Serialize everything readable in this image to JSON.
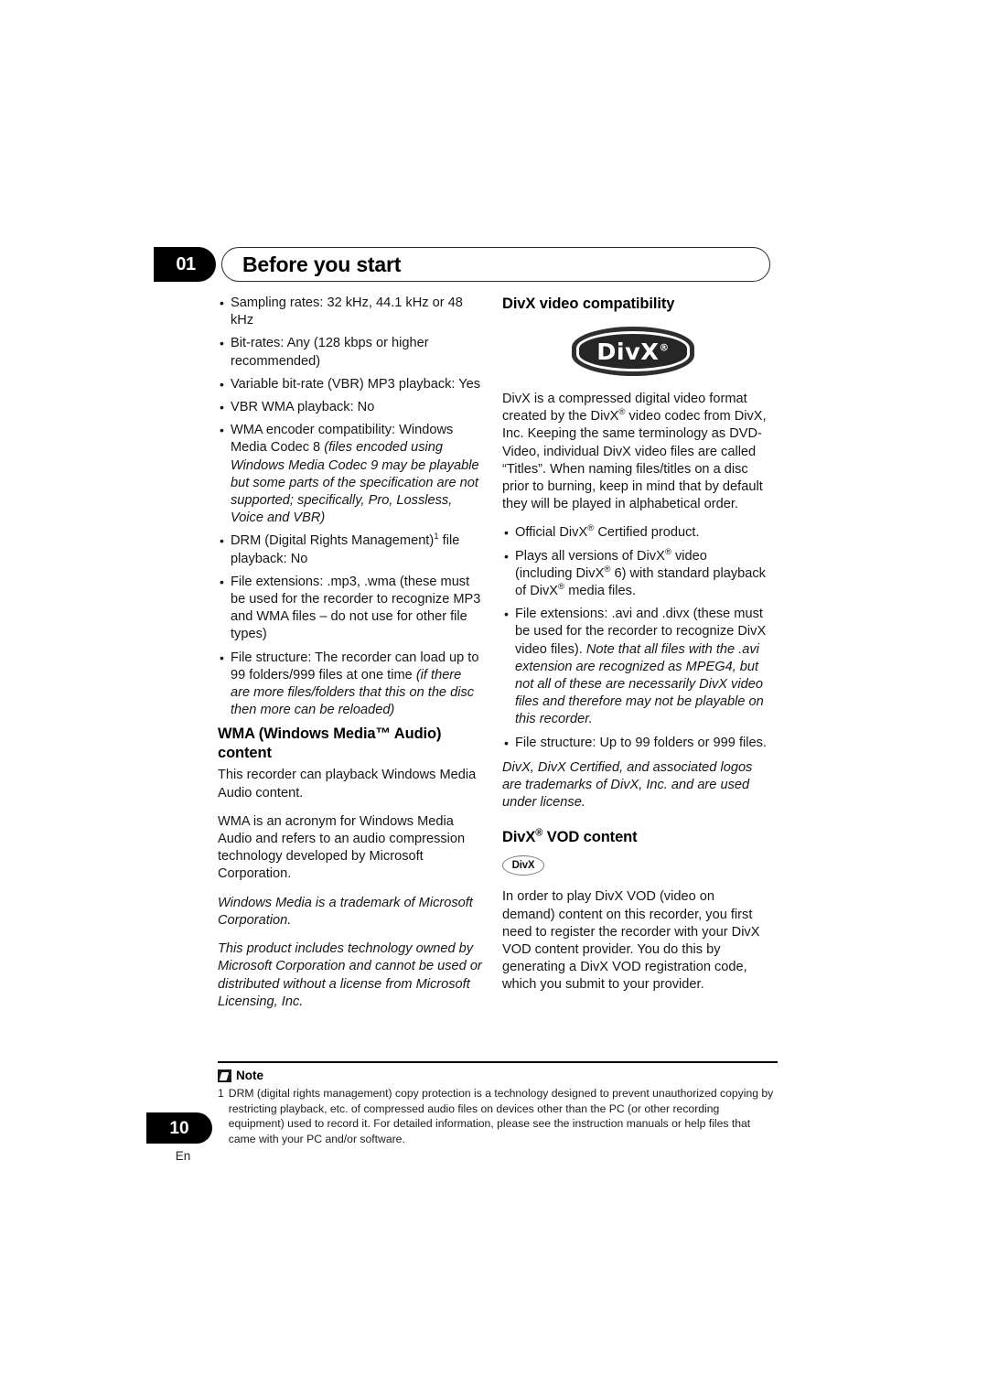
{
  "header": {
    "chapter_number": "01",
    "title": "Before you start"
  },
  "left_column": {
    "spec_bullets": [
      "Sampling rates: 32 kHz, 44.1 kHz or 48 kHz",
      "Bit-rates: Any (128 kbps or higher recommended)",
      "Variable bit-rate (VBR) MP3 playback: Yes",
      "VBR WMA playback: No"
    ],
    "wma_encoder_bullet": {
      "roman": "WMA encoder compatibility: Windows Media Codec 8 ",
      "italic": "(files encoded using Windows Media Codec 9 may be playable but some parts of the specification are not supported; specifically, Pro, Lossless, Voice and VBR)"
    },
    "drm_bullet": {
      "before_sup": "DRM (Digital Rights Management)",
      "sup": "1",
      "after_sup": " file playback: No"
    },
    "file_extensions_bullet": "File extensions: .mp3, .wma (these must be used for the recorder to recognize MP3 and WMA files – do not use for other file types)",
    "file_structure_bullet": {
      "roman": "File structure: The recorder can load up to 99 folders/999 files at one time ",
      "italic": "(if there are more files/folders that this on the disc then more can be reloaded)"
    },
    "wma_heading_line1": "WMA (Windows Media™ Audio)",
    "wma_heading_line2": "content",
    "wma_para_1": "This recorder can playback Windows Media Audio content.",
    "wma_para_2": "WMA is an acronym for Windows Media Audio and refers to an audio compression technology developed by Microsoft Corporation.",
    "wma_para_3_italic": "Windows Media is a trademark of Microsoft Corporation.",
    "wma_para_4_italic": "This product includes technology owned by Microsoft Corporation and cannot be used or distributed without a license from Microsoft Licensing, Inc."
  },
  "right_column": {
    "divx_heading": "DivX video compatibility",
    "divx_logo_text": "DivX",
    "divx_logo_mark": "®",
    "divx_intro": {
      "part1": "DivX is a compressed digital video format created by the DivX",
      "sup1": "®",
      "part2": " video codec from DivX, Inc. Keeping the same terminology as DVD-Video, individual DivX video files are called “Titles”. When naming files/titles on a disc prior to burning, keep in mind that by default they will be played in alphabetical order."
    },
    "bullet_official": {
      "before": "Official DivX",
      "sup": "®",
      "after": " Certified product."
    },
    "bullet_plays": {
      "p1": "Plays all versions of DivX",
      "s1": "®",
      "p2": " video (including DivX",
      "s2": "®",
      "p3": " 6) with standard playback of DivX",
      "s3": "®",
      "p4": " media files."
    },
    "bullet_file_extensions": {
      "roman": "File extensions: .avi and .divx (these must be used for the recorder to recognize DivX video files). ",
      "italic": "Note that all files with the .avi extension are recognized as MPEG4, but not all of these are necessarily DivX video files and therefore may not be playable on this recorder."
    },
    "bullet_file_structure": "File structure: Up to 99 folders or 999 files.",
    "trademark_note_italic": "DivX, DivX Certified, and associated logos are trademarks of DivX, Inc. and are used under license.",
    "vod_heading": {
      "before": "DivX",
      "sup": "®",
      "after": " VOD content"
    },
    "vod_badge_text": "DivX",
    "vod_para": "In order to play DivX VOD (video on demand) content on this recorder, you first need to register the recorder with your DivX VOD content provider. You do this by generating a DivX VOD registration code, which you submit to your provider."
  },
  "note": {
    "label": "Note",
    "footnote_number": "1",
    "footnote_text": "DRM (digital rights management) copy protection is a technology designed to prevent unauthorized copying by restricting playback, etc. of compressed audio files on devices other than the PC (or other recording equipment) used to record it. For detailed information, please see the instruction manuals or help files that came with your PC and/or software."
  },
  "footer": {
    "page_number": "10",
    "language": "En"
  }
}
